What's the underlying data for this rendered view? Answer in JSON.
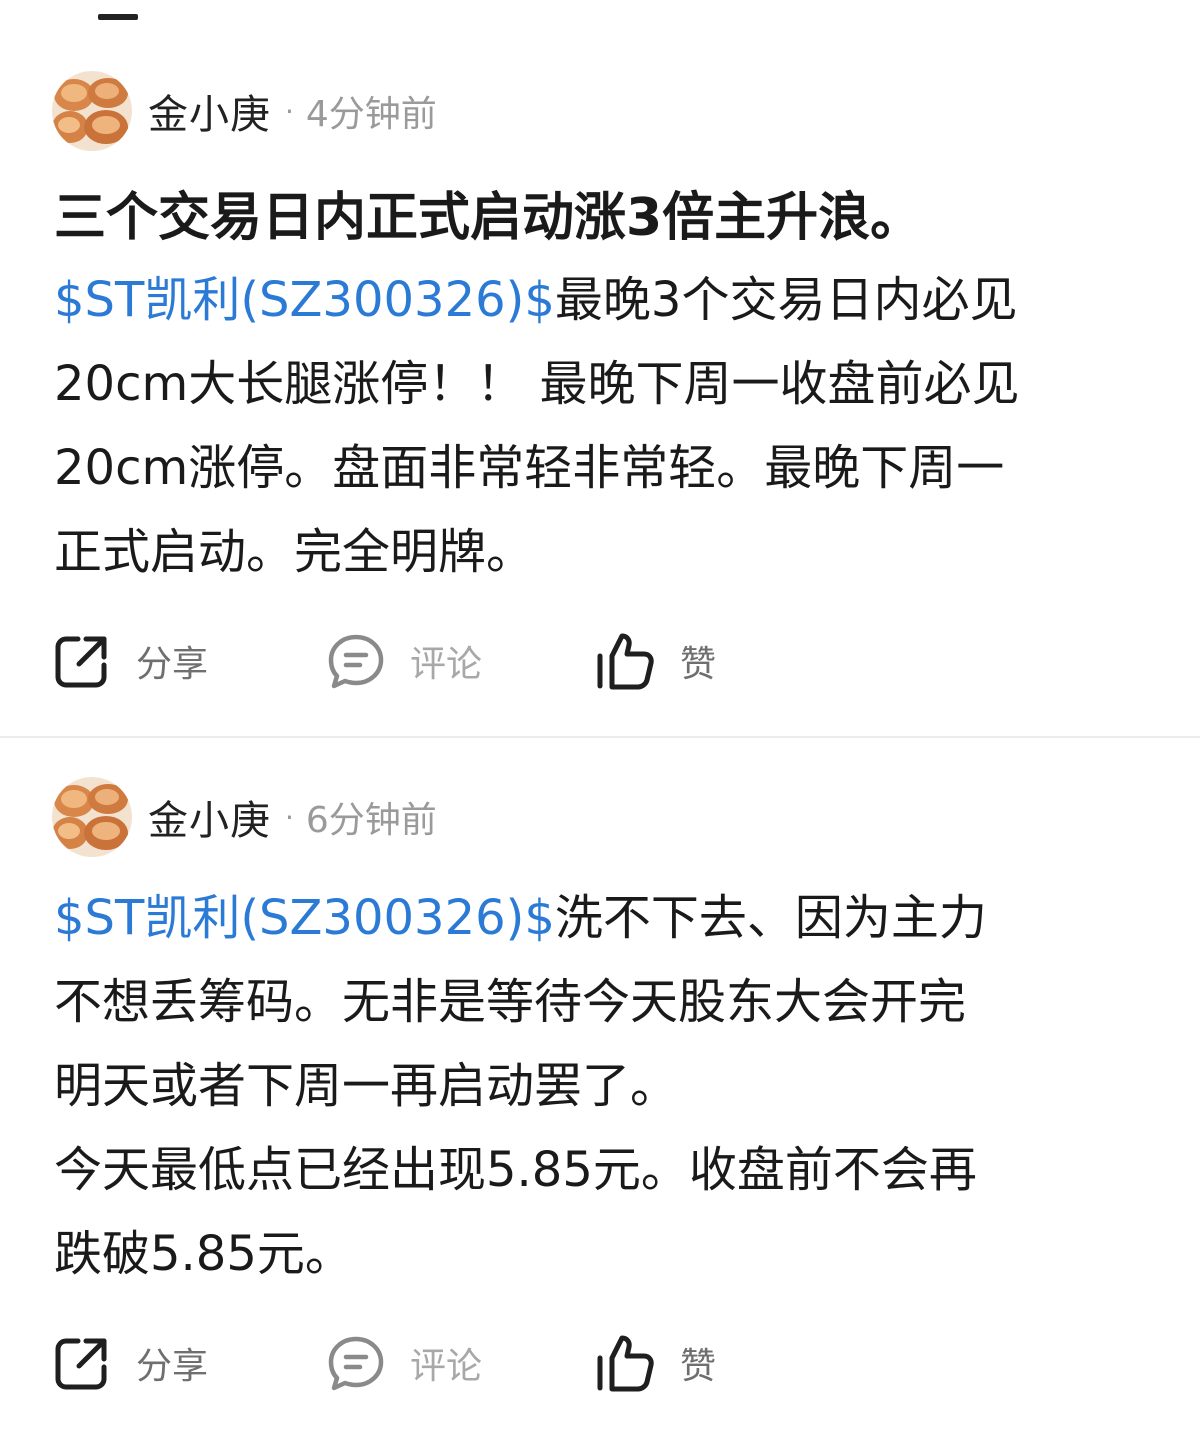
{
  "posts": [
    {
      "author": "金小庚",
      "separator": "·",
      "time": "4分钟前",
      "title": "三个交易日内正式启动涨3倍主升浪。",
      "body_lines": [
        "最晚3个交易日内必见",
        "20cm大长腿涨停！！ 最晚下周一收盘前必见",
        "20cm涨停。盘面非常轻非常轻。最晚下周一",
        "正式启动。完全明牌。"
      ],
      "stock_tag": "$ST凯利(SZ300326)$",
      "actions": {
        "share": "分享",
        "comment": "评论",
        "like": "赞"
      }
    },
    {
      "author": "金小庚",
      "separator": "·",
      "time": "6分钟前",
      "stock_tag": "$ST凯利(SZ300326)$",
      "body_lines": [
        "洗不下去、因为主力",
        "不想丢筹码。无非是等待今天股东大会开完",
        "明天或者下周一再启动罢了。",
        "今天最低点已经出现5.85元。收盘前不会再",
        "跌破5.85元。"
      ],
      "actions": {
        "share": "分享",
        "comment": "评论",
        "like": "赞"
      }
    }
  ],
  "colors": {
    "link": "#2a7ad6",
    "text": "#1a1a1a",
    "muted": "#9a9a9a"
  },
  "icons": {
    "share": "share-out-icon",
    "comment": "comment-bubble-icon",
    "like": "thumbs-up-icon"
  }
}
